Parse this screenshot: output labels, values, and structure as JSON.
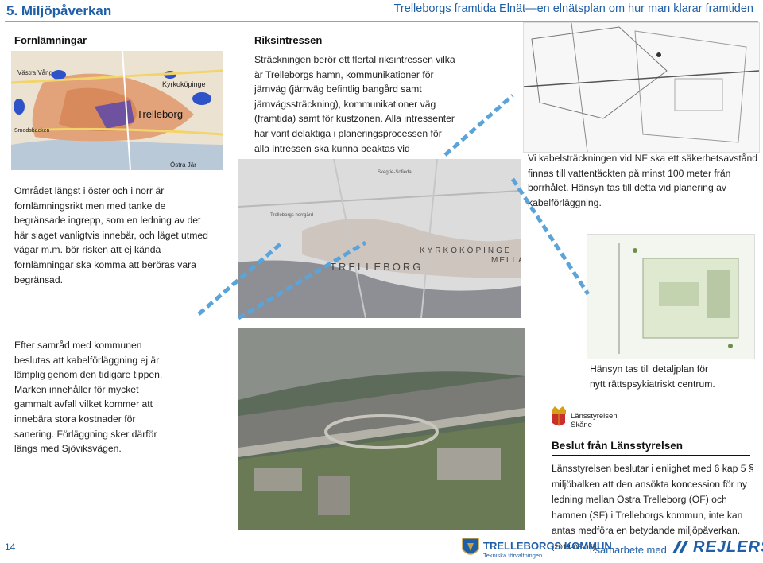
{
  "header": {
    "section_title": "5. Miljöpåverkan",
    "doc_title": "Trelleborgs framtida Elnät—en elnätsplan om hur man klarar framtiden"
  },
  "fornlamningar": {
    "heading": "Fornlämningar",
    "text": "Området längst i öster och i norr är fornlämningsrikt men med tanke de begränsade ingrepp, som en ledning av det här slaget vanligtvis innebär, och läget utmed vägar m.m. bör risken att ej kända fornlämningar ska komma att beröras vara begränsad.",
    "map_labels": [
      "Västra Vång",
      "Kyrkoköpinge",
      "Trelleborg",
      "Östra Jär",
      "Smedsbacken"
    ]
  },
  "riksintressen": {
    "heading": "Riksintressen",
    "text": "Sträckningen berör ett flertal riksintressen vilka är Trelleborgs hamn, kommunikationer för järnväg (järnväg befintlig bangård samt järnvägssträckning), kommunikationer väg (framtida) samt för kustzonen. Alla intressenter har varit delaktiga i planeringsprocessen för alla intressen ska kunna beaktas vid kabelförläggningen."
  },
  "map2_labels": [
    "TRELLEBORG",
    "KYRKOKÖPINGE",
    "MELLAN",
    "Skegrie-Sofiedal",
    "Trelleborgs herrgård"
  ],
  "nf": {
    "text": "Vi kabelsträckningen vid NF ska ett säkerhetsavstånd finnas till vattentäckten på minst 100 meter från borrhålet. Hänsyn tas till detta vid planering av kabelförläggning."
  },
  "samrad": {
    "text": "Efter samråd med kommunen beslutas att kabelförläggning ej är lämplig genom den tidigare tippen. Marken innehåller för mycket gammalt avfall vilket kommer att innebära stora kostnader för sanering. Förläggning sker därför längs med Sjöviksvägen."
  },
  "detaljplan": {
    "text": "Hänsyn tas till detaljplan för nytt rättspsykiatriskt centrum."
  },
  "lansstyrelsen": {
    "logo_line1": "Länsstyrelsen",
    "logo_line2": "Skåne",
    "heading": "Beslut från Länsstyrelsen",
    "text": "Länsstyrelsen beslutar i enlighet med 6 kap 5 § miljöbalken att den ansökta koncession för ny ledning mellan Östra Trelleborg (ÖF) och hamnen (SF) i Trelleborgs kommun, inte kan antas medföra en betydande miljöpåverkan.",
    "date": "(2014-05-05)"
  },
  "footer": {
    "page_number": "14",
    "kommun_name": "TRELLEBORGS KOMMUN",
    "kommun_sub": "Tekniska förvaltningen",
    "samarbete": "i samarbete med",
    "rejlers": "REJLERS"
  },
  "colors": {
    "blue": "#1f5fa8",
    "gold": "#c9a13c",
    "arrow": "#5ba4d9"
  }
}
